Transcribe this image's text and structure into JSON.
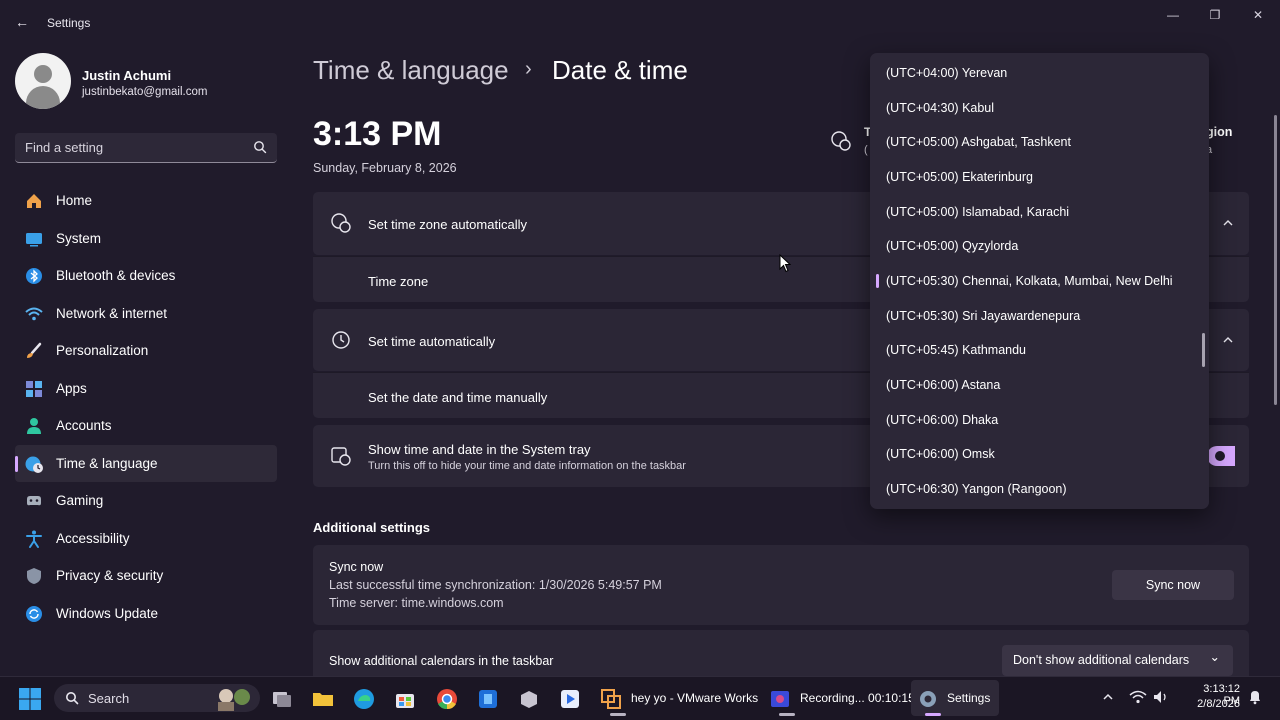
{
  "window": {
    "title": "Settings",
    "back_glyph": "←",
    "minimize_glyph": "—",
    "maximize_glyph": "❐",
    "close_glyph": "✕"
  },
  "user": {
    "name": "Justin Achumi",
    "email": "justinbekato@gmail.com"
  },
  "search": {
    "placeholder": "Find a setting"
  },
  "sidebar": {
    "items": [
      {
        "label": "Home",
        "icon": "home-icon"
      },
      {
        "label": "System",
        "icon": "system-icon"
      },
      {
        "label": "Bluetooth & devices",
        "icon": "bluetooth-icon"
      },
      {
        "label": "Network & internet",
        "icon": "wifi-icon"
      },
      {
        "label": "Personalization",
        "icon": "brush-icon"
      },
      {
        "label": "Apps",
        "icon": "apps-icon"
      },
      {
        "label": "Accounts",
        "icon": "accounts-icon"
      },
      {
        "label": "Time & language",
        "icon": "globe-clock-icon",
        "active": true
      },
      {
        "label": "Gaming",
        "icon": "gamepad-icon"
      },
      {
        "label": "Accessibility",
        "icon": "accessibility-icon"
      },
      {
        "label": "Privacy & security",
        "icon": "shield-icon"
      },
      {
        "label": "Windows Update",
        "icon": "update-icon"
      }
    ]
  },
  "breadcrumb": {
    "parent": "Time & language",
    "separator": "›",
    "current": "Date & time"
  },
  "clock": {
    "time": "3:13 PM",
    "date": "Sunday, February 8, 2026"
  },
  "region_fragments": {
    "left_top": "T",
    "left_bottom": "(",
    "right_top": "gion",
    "right_bottom": "a"
  },
  "settings": {
    "set_tz_auto": "Set time zone automatically",
    "time_zone": "Time zone",
    "set_time_auto": "Set time automatically",
    "set_manual": "Set the date and time manually",
    "tray_title": "Show time and date in the System tray",
    "tray_desc": "Turn this off to hide your time and date information on the taskbar"
  },
  "additional": {
    "heading": "Additional settings",
    "sync_title": "Sync now",
    "sync_last": "Last successful time synchronization: 1/30/2026 5:49:57 PM",
    "sync_server": "Time server: time.windows.com",
    "sync_button": "Sync now",
    "calendars_label": "Show additional calendars in the taskbar",
    "calendars_value": "Don't show additional calendars",
    "calendars_chevron": "⌄"
  },
  "timezone_list": [
    "(UTC+04:00) Yerevan",
    "(UTC+04:30) Kabul",
    "(UTC+05:00) Ashgabat, Tashkent",
    "(UTC+05:00) Ekaterinburg",
    "(UTC+05:00) Islamabad, Karachi",
    "(UTC+05:00) Qyzylorda",
    "(UTC+05:30) Chennai, Kolkata, Mumbai, New Delhi",
    "(UTC+05:30) Sri Jayawardenepura",
    "(UTC+05:45) Kathmandu",
    "(UTC+06:00) Astana",
    "(UTC+06:00) Dhaka",
    "(UTC+06:00) Omsk",
    "(UTC+06:30) Yangon (Rangoon)"
  ],
  "timezone_selected_index": 6,
  "taskbar": {
    "search_label": "Search",
    "apps": [
      {
        "label": "hey yo - VMware Works",
        "icon": "vmware-icon"
      },
      {
        "label": "Recording... 00:10:15",
        "icon": "recorder-icon"
      },
      {
        "label": "Settings",
        "icon": "settings-gear-icon"
      }
    ],
    "tray_time": "3:13:12 PM",
    "tray_date": "2/8/2026"
  },
  "colors": {
    "accent": "#d6a8ff",
    "background": "#201b2b",
    "card": "#2b2636"
  }
}
